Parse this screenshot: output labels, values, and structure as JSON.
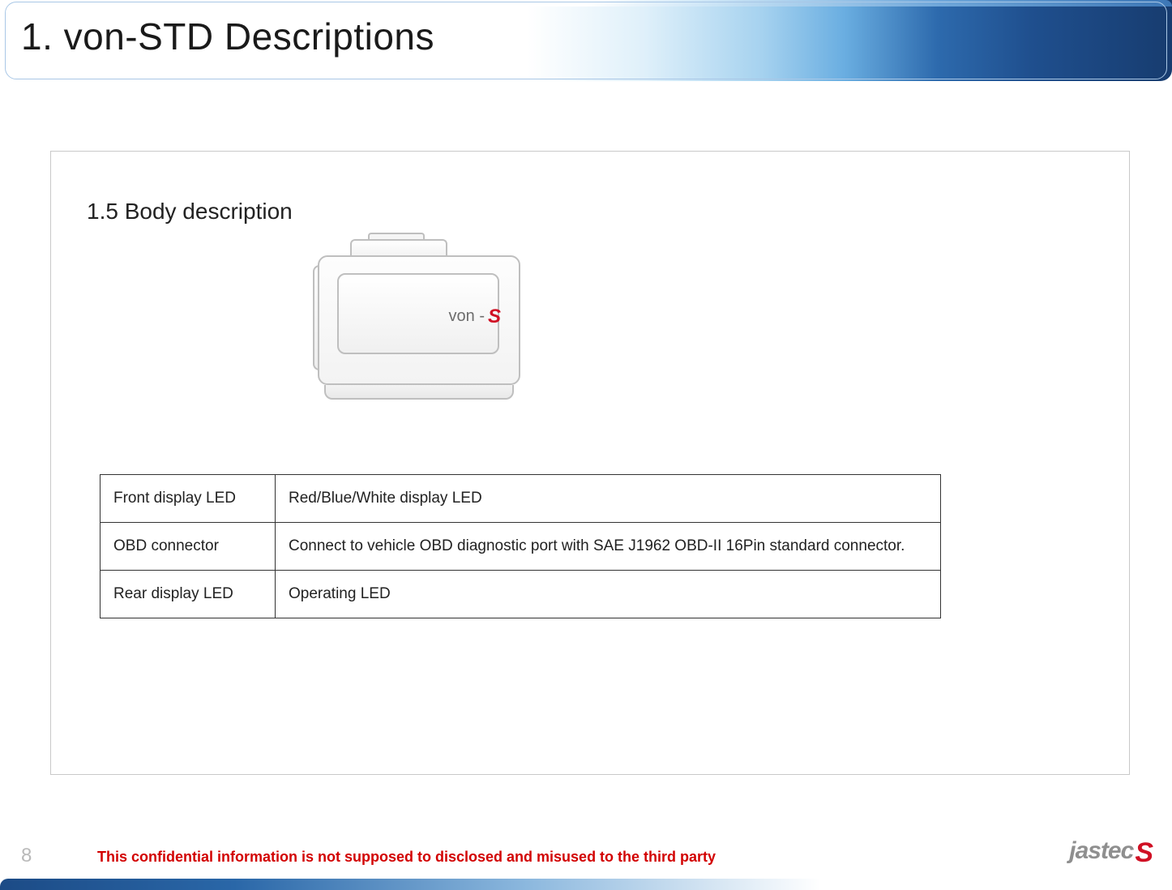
{
  "header": {
    "title": "1. von-STD Descriptions"
  },
  "section": {
    "title": "1.5 Body description"
  },
  "device_logo": {
    "prefix": "von -",
    "mark": "S"
  },
  "table": {
    "rows": [
      {
        "label": "Front display LED",
        "desc": "Red/Blue/White display LED"
      },
      {
        "label": "OBD connector",
        "desc": "Connect to vehicle OBD diagnostic port with SAE J1962 OBD-II 16Pin standard connector."
      },
      {
        "label": "Rear display LED",
        "desc": "Operating LED"
      }
    ]
  },
  "footer": {
    "page_number": "8",
    "confidential": "This confidential information is not supposed to disclosed and misused to the third party",
    "brand": "jastec",
    "brand_mark": "S"
  }
}
